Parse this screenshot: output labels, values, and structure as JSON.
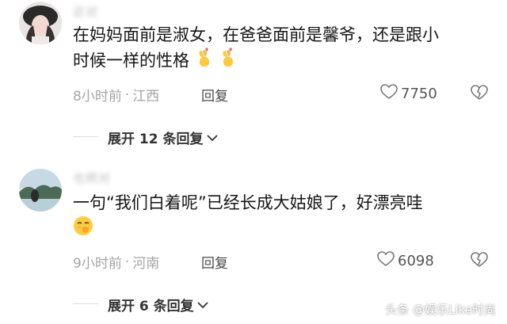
{
  "comments": [
    {
      "username": "近对",
      "text_line1": "在妈妈面前是淑女，在爸爸面前是馨爷，还是跟小",
      "text_line2": "时候一样的性格",
      "emojis": [
        "finger-heart-emoji",
        "finger-heart-emoji"
      ],
      "time": "8小时前",
      "location": "江西",
      "reply_label": "回复",
      "likes": "7750",
      "expand_label": "展开 12 条回复"
    },
    {
      "username": "也频对",
      "text_line1": "一句“我们白着呢”已经长成大姑娘了，好漂亮哇",
      "emojis": [
        "hand-over-mouth-emoji"
      ],
      "time": "9小时前",
      "location": "河南",
      "reply_label": "回复",
      "likes": "6098",
      "expand_label": "展开 6 条回复"
    }
  ],
  "watermark": "头条 @娱乐Like时尚",
  "colors": {
    "meta": "#a4a4a4",
    "text": "#161616",
    "divider": "#dcdcdc"
  }
}
